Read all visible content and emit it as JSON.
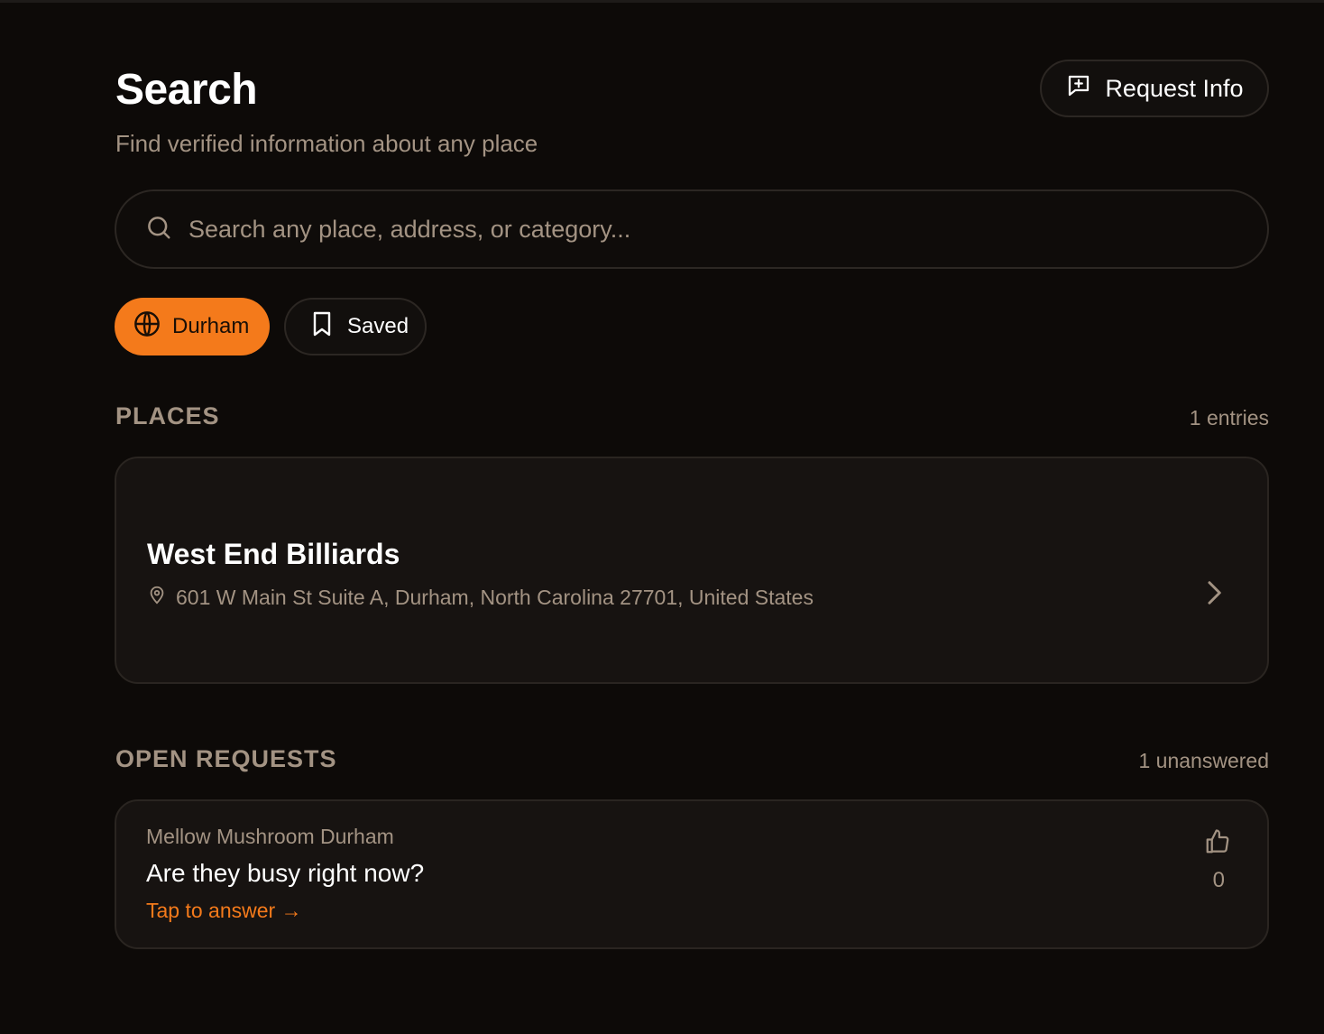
{
  "header": {
    "title": "Search",
    "subtitle": "Find verified information about any place",
    "request_button_label": "Request Info",
    "request_icon": "message-plus-icon"
  },
  "search": {
    "placeholder": "Search any place, address, or category...",
    "value": "",
    "icon": "search-icon"
  },
  "filters": [
    {
      "label": "Durham",
      "icon": "globe-icon",
      "active": true
    },
    {
      "label": "Saved",
      "icon": "bookmark-icon",
      "active": false
    }
  ],
  "places_section": {
    "title": "PLACES",
    "count_label": "1 entries",
    "items": [
      {
        "name": "West End Billiards",
        "address": "601 W Main St Suite A, Durham, North Carolina 27701, United States",
        "address_icon": "map-pin-icon",
        "action_icon": "chevron-right-icon"
      }
    ]
  },
  "requests_section": {
    "title": "OPEN REQUESTS",
    "count_label": "1 unanswered",
    "items": [
      {
        "place": "Mellow Mushroom Durham",
        "question": "Are they busy right now?",
        "cta": "Tap to answer →",
        "vote_icon": "thumbs-up-icon",
        "votes": "0"
      }
    ]
  },
  "colors": {
    "background": "#0d0a08",
    "card": "#171311",
    "border": "#2c2723",
    "accent": "#f47a1b",
    "muted_text": "#a39383",
    "text": "#ffffff"
  }
}
